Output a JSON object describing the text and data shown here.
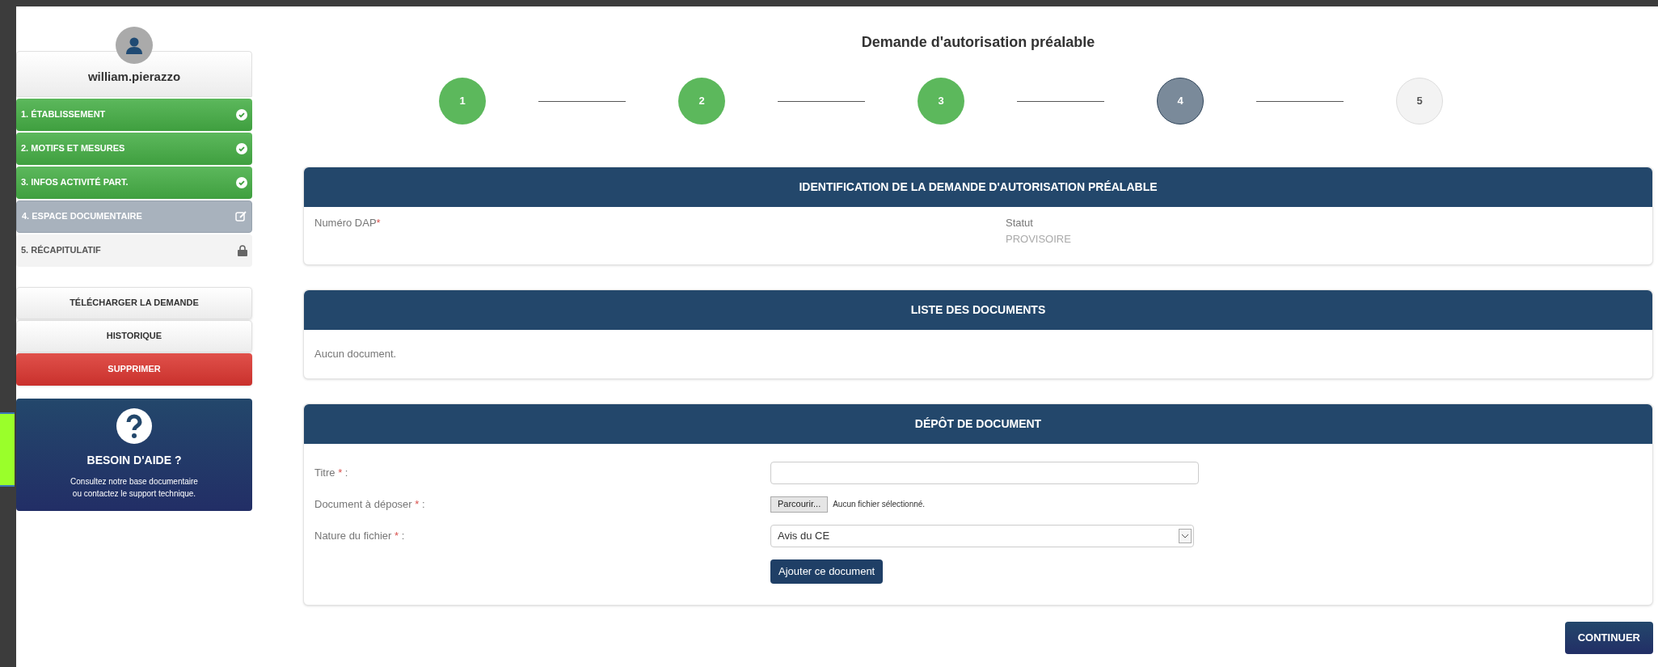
{
  "user": {
    "name": "william.pierazzo"
  },
  "sidebar": {
    "items": [
      {
        "label": "1. ÉTABLISSEMENT",
        "completed": true,
        "selected": false,
        "locked": false
      },
      {
        "label": "2. MOTIFS ET MESURES",
        "completed": true,
        "selected": false,
        "locked": false
      },
      {
        "label": "3. INFOS ACTIVITÉ PART.",
        "completed": true,
        "selected": false,
        "locked": false
      },
      {
        "label": "4. ESPACE DOCUMENTAIRE",
        "completed": false,
        "selected": true,
        "locked": false
      },
      {
        "label": "5. RÉCAPITULATIF",
        "completed": false,
        "selected": false,
        "locked": true
      }
    ],
    "actions": [
      {
        "label": "TÉLÉCHARGER LA DEMANDE",
        "kind": "default"
      },
      {
        "label": "HISTORIQUE",
        "kind": "default"
      },
      {
        "label": "SUPPRIMER",
        "kind": "danger"
      }
    ],
    "help": {
      "title": "BESOIN D'AIDE ?",
      "text": "Consultez notre base documentaire ou contactez le support technique."
    }
  },
  "page_title": "Demande d'autorisation préalable",
  "steps": [
    {
      "label": "1",
      "completed": true,
      "selected": false
    },
    {
      "label": "2",
      "completed": true,
      "selected": false
    },
    {
      "label": "3",
      "completed": true,
      "selected": false
    },
    {
      "label": "4",
      "completed": false,
      "selected": true
    },
    {
      "label": "5",
      "completed": false,
      "selected": false
    }
  ],
  "identification": {
    "title": "IDENTIFICATION DE LA DEMANDE D'AUTORISATION PRÉALABLE",
    "number_label": "Numéro DAP",
    "required_mark": "*",
    "status_label": "Statut",
    "status_value": "PROVISOIRE"
  },
  "documents": {
    "title": "LISTE DES DOCUMENTS",
    "empty_text": "Aucun document."
  },
  "upload": {
    "title": "DÉPÔT DE DOCUMENT",
    "fields": [
      {
        "label": "Titre",
        "required_mark": "*",
        "suffix": ":",
        "kind": "text"
      },
      {
        "label": "Document à déposer",
        "required_mark": "*",
        "suffix": ":",
        "kind": "file",
        "button": "Parcourir...",
        "file_status": "Aucun fichier sélectionné."
      },
      {
        "label": "Nature du fichier",
        "required_mark": "*",
        "suffix": ":",
        "kind": "select",
        "value": "Avis du CE"
      }
    ],
    "submit": "Ajouter ce document"
  },
  "continue_button": "CONTINUER"
}
